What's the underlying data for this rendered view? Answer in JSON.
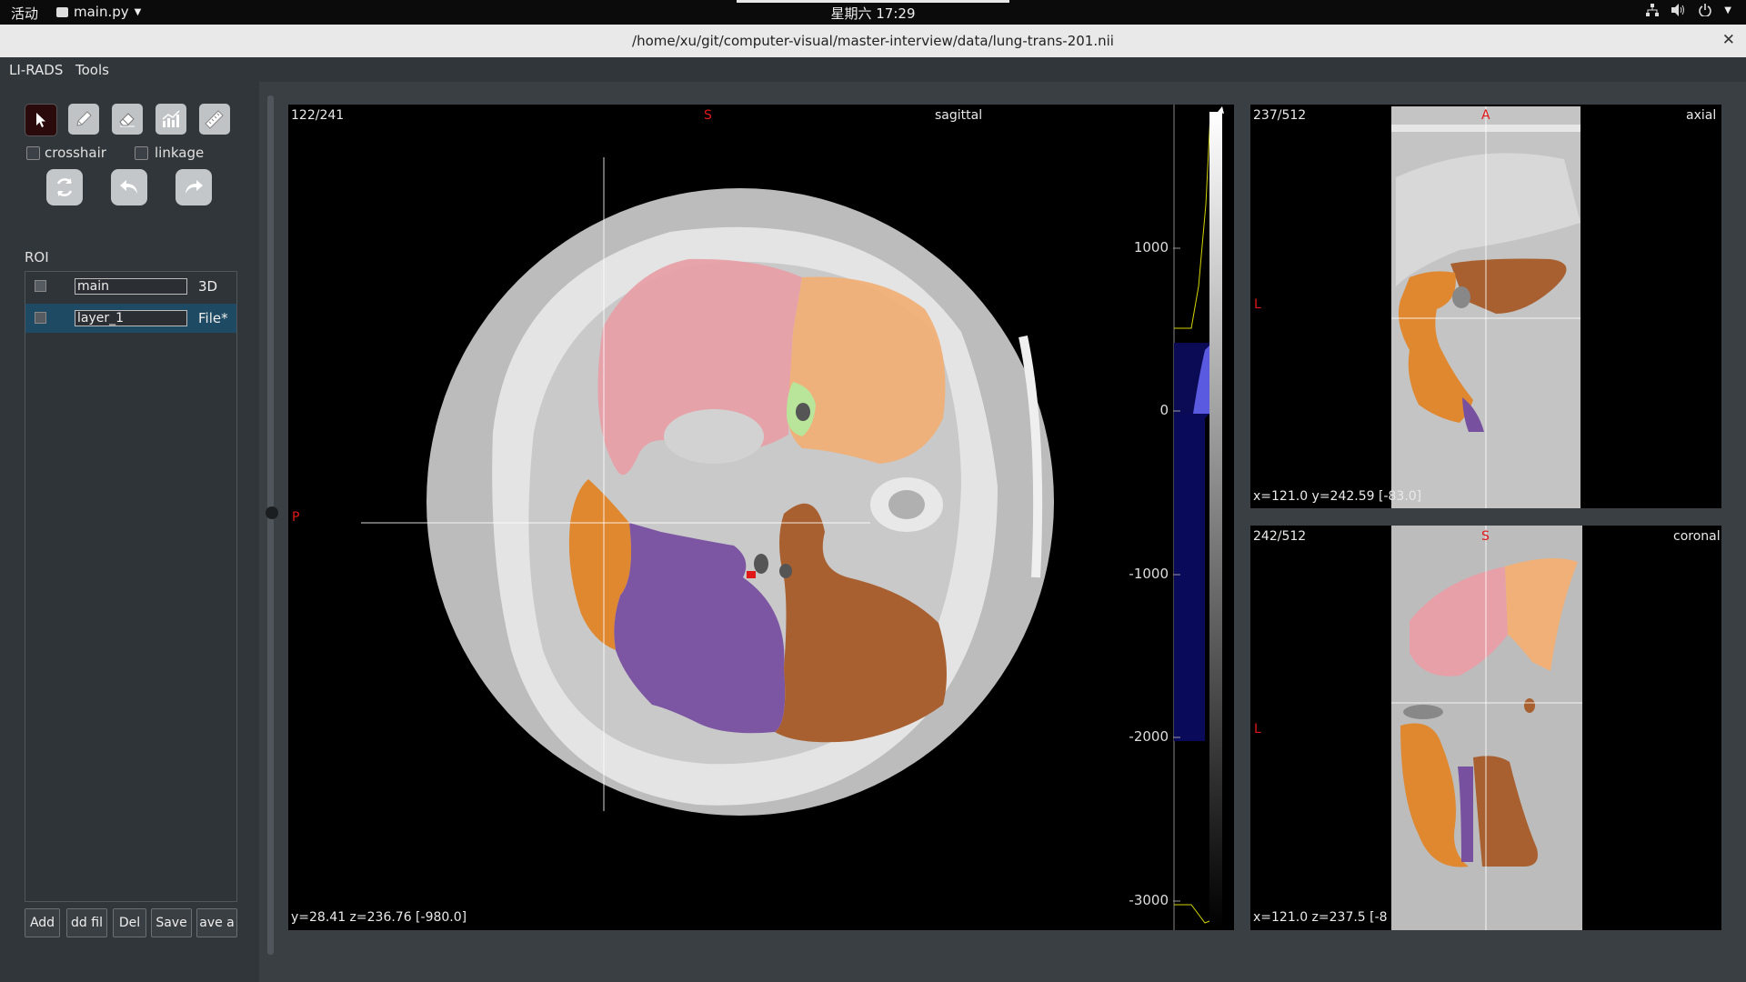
{
  "topbar": {
    "activities": "活动",
    "app_name": "main.py",
    "clock": "星期六 17:29"
  },
  "window": {
    "title": "/home/xu/git/computer-visual/master-interview/data/lung-trans-201.nii",
    "close_icon": "close-icon"
  },
  "menu": {
    "items": [
      "LI-RADS",
      "Tools"
    ]
  },
  "toolbar": {
    "tools": [
      "pointer-icon",
      "pencil-icon",
      "eraser-icon",
      "histogram-icon",
      "ruler-icon"
    ],
    "crosshair_label": "crosshair",
    "linkage_label": "linkage",
    "actions": [
      "refresh-icon",
      "undo-icon",
      "redo-icon"
    ]
  },
  "roi": {
    "title": "ROI",
    "rows": [
      {
        "name": "main",
        "tag": "3D"
      },
      {
        "name": "layer_1",
        "tag": "File*"
      }
    ],
    "buttons": [
      "Add",
      "dd fil",
      "Del",
      "Save",
      "ave a"
    ]
  },
  "viewers": {
    "sagittal": {
      "slice": "122/241",
      "top_marker": "S",
      "left_marker": "P",
      "name": "sagittal",
      "coords": "y=28.41   z=236.76    [-980.0]"
    },
    "axial": {
      "slice": "237/512",
      "top_marker": "A",
      "left_marker": "L",
      "name": "axial",
      "coords": "x=121.0   y=242.59    [-83.0]"
    },
    "coronal": {
      "slice": "242/512",
      "top_marker": "S",
      "left_marker": "L",
      "name": "coronal",
      "coords": "x=121.0   z=237.5    [-8"
    }
  },
  "histogram": {
    "tick_labels": [
      "1000",
      "0",
      "-1000",
      "-2000",
      "-3000"
    ]
  },
  "colors": {
    "accent_red": "#e01818",
    "lobe_pink": "#e8a0a8",
    "lobe_peach": "#f0b078",
    "lobe_orange": "#e08830",
    "lobe_purple": "#7850a0",
    "lobe_brown": "#a86030",
    "histogram_fill": "#0a0a5a"
  }
}
